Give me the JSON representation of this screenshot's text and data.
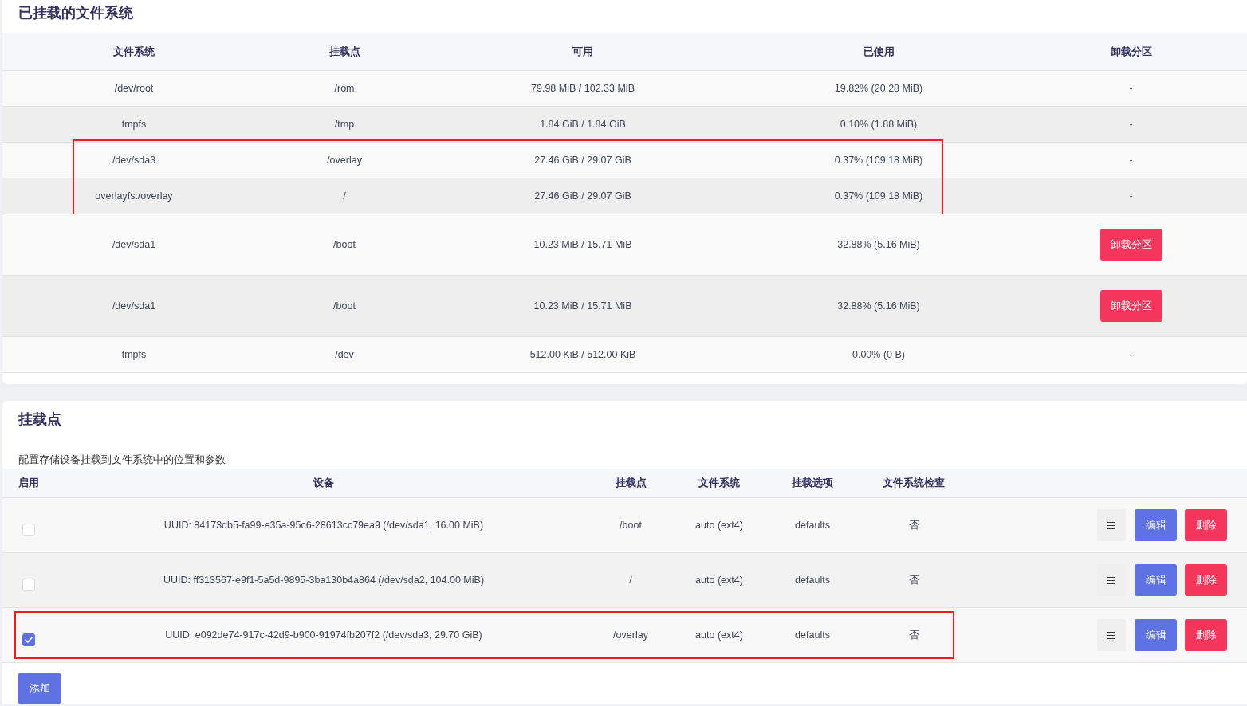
{
  "mounted_filesystems": {
    "title": "已挂载的文件系统",
    "columns": [
      "文件系统",
      "挂载点",
      "可用",
      "已使用",
      "卸载分区"
    ],
    "rows": [
      {
        "filesystem": "/dev/root",
        "mount_point": "/rom",
        "available": "79.98 MiB / 102.33 MiB",
        "used": "19.82% (20.28 MiB)",
        "unmount": {
          "kind": "text",
          "label": "-"
        },
        "highlighted": false
      },
      {
        "filesystem": "tmpfs",
        "mount_point": "/tmp",
        "available": "1.84 GiB / 1.84 GiB",
        "used": "0.10% (1.88 MiB)",
        "unmount": {
          "kind": "text",
          "label": "-"
        },
        "highlighted": false
      },
      {
        "filesystem": "/dev/sda3",
        "mount_point": "/overlay",
        "available": "27.46 GiB / 29.07 GiB",
        "used": "0.37% (109.18 MiB)",
        "unmount": {
          "kind": "text",
          "label": "-"
        },
        "highlighted": true
      },
      {
        "filesystem": "overlayfs:/overlay",
        "mount_point": "/",
        "available": "27.46 GiB / 29.07 GiB",
        "used": "0.37% (109.18 MiB)",
        "unmount": {
          "kind": "text",
          "label": "-"
        },
        "highlighted": true
      },
      {
        "filesystem": "/dev/sda1",
        "mount_point": "/boot",
        "available": "10.23 MiB / 15.71 MiB",
        "used": "32.88% (5.16 MiB)",
        "unmount": {
          "kind": "button",
          "label": "卸载分区"
        },
        "highlighted": false
      },
      {
        "filesystem": "/dev/sda1",
        "mount_point": "/boot",
        "available": "10.23 MiB / 15.71 MiB",
        "used": "32.88% (5.16 MiB)",
        "unmount": {
          "kind": "button",
          "label": "卸载分区"
        },
        "highlighted": false
      },
      {
        "filesystem": "tmpfs",
        "mount_point": "/dev",
        "available": "512.00 KiB / 512.00 KiB",
        "used": "0.00% (0 B)",
        "unmount": {
          "kind": "text",
          "label": "-"
        },
        "highlighted": false
      }
    ]
  },
  "mount_points": {
    "title": "挂载点",
    "description": "配置存储设备挂载到文件系统中的位置和参数",
    "columns": [
      "启用",
      "设备",
      "挂载点",
      "文件系统",
      "挂载选项",
      "文件系统检查"
    ],
    "rows": [
      {
        "enabled": false,
        "device": "UUID: 84173db5-fa99-e35a-95c6-28613cc79ea9 (/dev/sda1, 16.00 MiB)",
        "mount_point": "/boot",
        "filesystem": "auto (ext4)",
        "options": "defaults",
        "fsck": "否",
        "actions": [
          {
            "kind": "menu"
          },
          {
            "kind": "edit",
            "label": "编辑"
          },
          {
            "kind": "delete",
            "label": "删除"
          }
        ],
        "highlighted": false
      },
      {
        "enabled": false,
        "device": "UUID: ff313567-e9f1-5a5d-9895-3ba130b4a864 (/dev/sda2, 104.00 MiB)",
        "mount_point": "/",
        "filesystem": "auto (ext4)",
        "options": "defaults",
        "fsck": "否",
        "actions": [
          {
            "kind": "menu"
          },
          {
            "kind": "edit",
            "label": "编辑"
          },
          {
            "kind": "delete",
            "label": "删除"
          }
        ],
        "highlighted": false
      },
      {
        "enabled": true,
        "device": "UUID: e092de74-917c-42d9-b900-91974fb207f2 (/dev/sda3, 29.70 GiB)",
        "mount_point": "/overlay",
        "filesystem": "auto (ext4)",
        "options": "defaults",
        "fsck": "否",
        "actions": [
          {
            "kind": "menu"
          },
          {
            "kind": "edit",
            "label": "编辑"
          },
          {
            "kind": "delete",
            "label": "删除"
          }
        ],
        "highlighted": true
      }
    ],
    "add_button": "添加"
  }
}
